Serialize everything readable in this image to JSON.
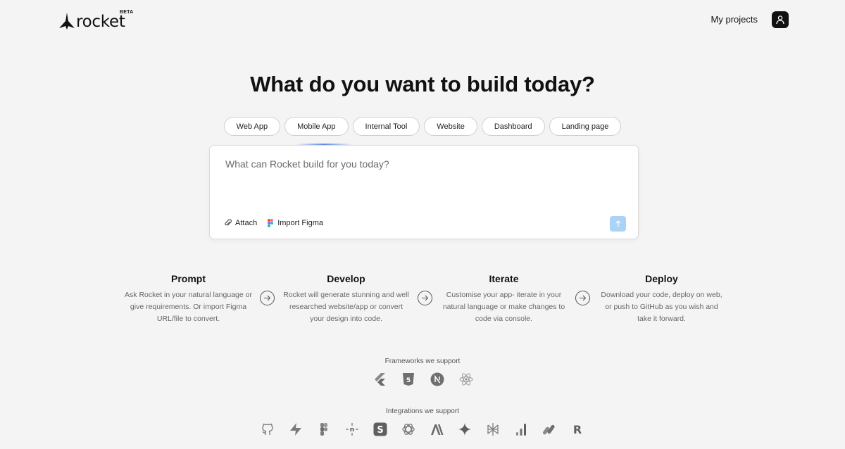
{
  "header": {
    "logo_text": "rocket",
    "beta_label": "BETA",
    "my_projects_label": "My projects"
  },
  "hero": {
    "title": "What do you want to build today?"
  },
  "chips": [
    "Web App",
    "Mobile App",
    "Internal Tool",
    "Website",
    "Dashboard",
    "Landing page"
  ],
  "prompt": {
    "placeholder": "What can Rocket build for you today?",
    "value": "",
    "attach_label": "Attach",
    "import_figma_label": "Import Figma"
  },
  "steps": [
    {
      "title": "Prompt",
      "desc": "Ask Rocket in your natural language or give requirements. Or import Figma URL/file to convert."
    },
    {
      "title": "Develop",
      "desc": "Rocket will generate stunning and well researched website/app or convert your design into code."
    },
    {
      "title": "Iterate",
      "desc": "Customise your app- iterate in your natural language or make changes to code via console."
    },
    {
      "title": "Deploy",
      "desc": "Download your code, deploy on web, or push to GitHub as you wish and take it forward."
    }
  ],
  "frameworks": {
    "label": "Frameworks we support",
    "icons": [
      "flutter-icon",
      "html5-icon",
      "nextjs-icon",
      "react-icon"
    ]
  },
  "integrations": {
    "label": "Integrations we support",
    "icons": [
      "github-icon",
      "supabase-icon",
      "figma-icon",
      "netlify-icon",
      "stripe-icon",
      "openai-icon",
      "anthropic-icon",
      "gemini-icon",
      "perplexity-icon",
      "analytics-icon",
      "resend-icon",
      "razorpay-icon"
    ]
  },
  "colors": {
    "background": "#f4f4f4",
    "send_button": "#a9d3f7",
    "text": "#111111"
  }
}
